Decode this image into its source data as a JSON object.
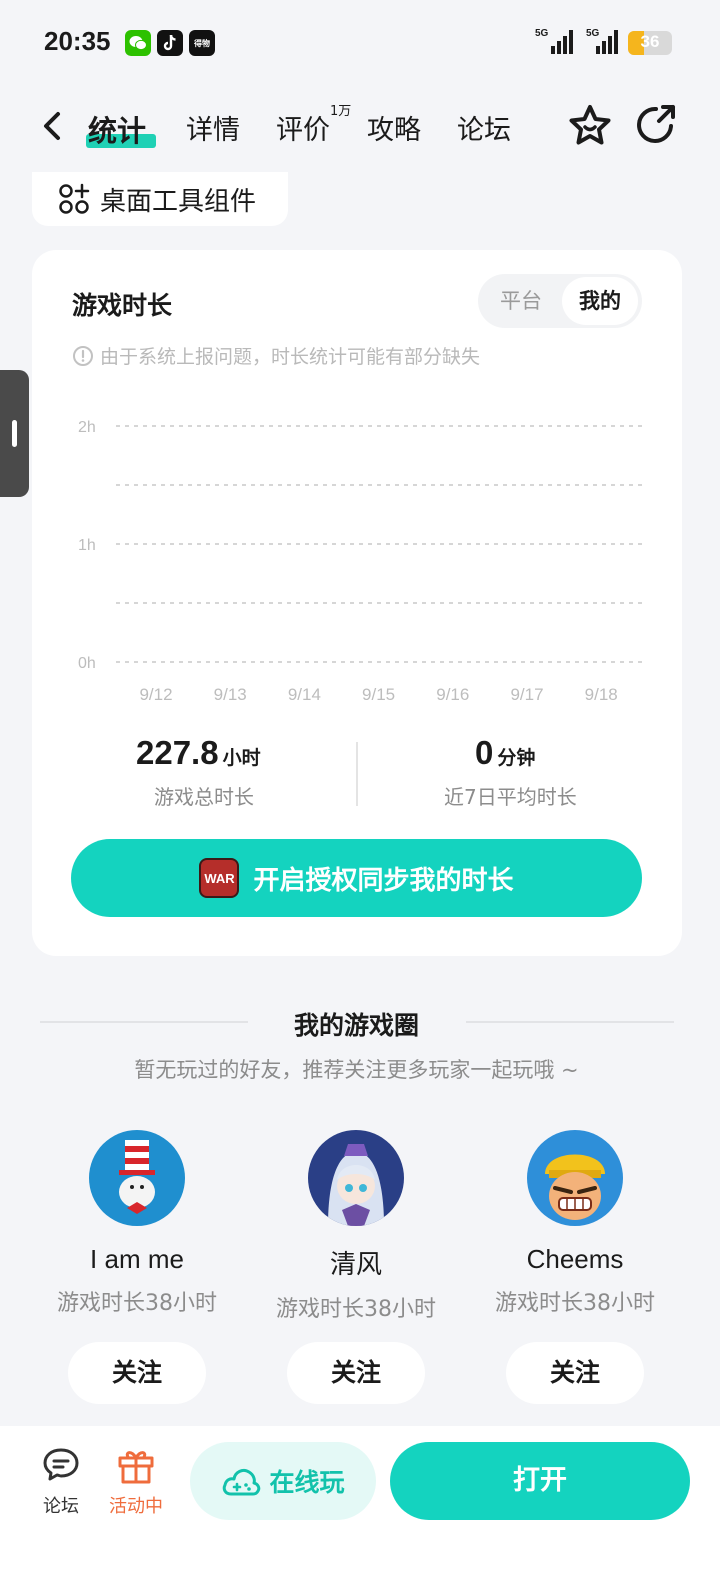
{
  "status_bar": {
    "time": "20:35",
    "apps": [
      "wechat-icon",
      "tiktok-icon",
      "dewu-icon"
    ],
    "dewu_label": "得物",
    "signal1": "5G",
    "signal2": "5G",
    "battery": "36",
    "battery_level": 0.36
  },
  "nav": {
    "tabs": [
      {
        "label": "统计",
        "active": true
      },
      {
        "label": "详情",
        "active": false
      },
      {
        "label": "评价",
        "active": false
      },
      {
        "label": "攻略",
        "active": false
      },
      {
        "label": "论坛",
        "active": false
      }
    ],
    "review_badge": "1万"
  },
  "widget_chip": {
    "label": "桌面工具组件"
  },
  "playtime_card": {
    "title": "游戏时长",
    "toggle": {
      "options": [
        "平台",
        "我的"
      ],
      "selected": "我的"
    },
    "notice": "由于系统上报问题，时长统计可能有部分缺失",
    "total": {
      "value": "227.8",
      "unit": "小时",
      "label": "游戏总时长"
    },
    "average": {
      "value": "0",
      "unit": "分钟",
      "label": "近7日平均时长"
    },
    "sync_button": {
      "label": "开启授权同步我的时长",
      "logo_text": "WAR"
    }
  },
  "chart_data": {
    "type": "bar",
    "categories": [
      "9/12",
      "9/13",
      "9/14",
      "9/15",
      "9/16",
      "9/17",
      "9/18"
    ],
    "values": [
      0,
      0,
      0,
      0,
      0,
      0,
      0
    ],
    "yticks": [
      "2h",
      "1h",
      "0h"
    ],
    "ylim": [
      0,
      2
    ],
    "grid": true
  },
  "game_circle": {
    "title": "我的游戏圈",
    "subtitle": "暂无玩过的好友，推荐关注更多玩家一起玩哦 ~",
    "friends": [
      {
        "name": "I am me",
        "hours": "游戏时长38小时",
        "follow": "关注"
      },
      {
        "name": "清风",
        "hours": "游戏时长38小时",
        "follow": "关注"
      },
      {
        "name": "Cheems",
        "hours": "游戏时长38小时",
        "follow": "关注"
      }
    ]
  },
  "bottom_bar": {
    "forum": "论坛",
    "events": "活动中",
    "play_online": "在线玩",
    "open": "打开"
  },
  "colors": {
    "accent": "#14d3bf",
    "events": "#ef6c3c"
  }
}
